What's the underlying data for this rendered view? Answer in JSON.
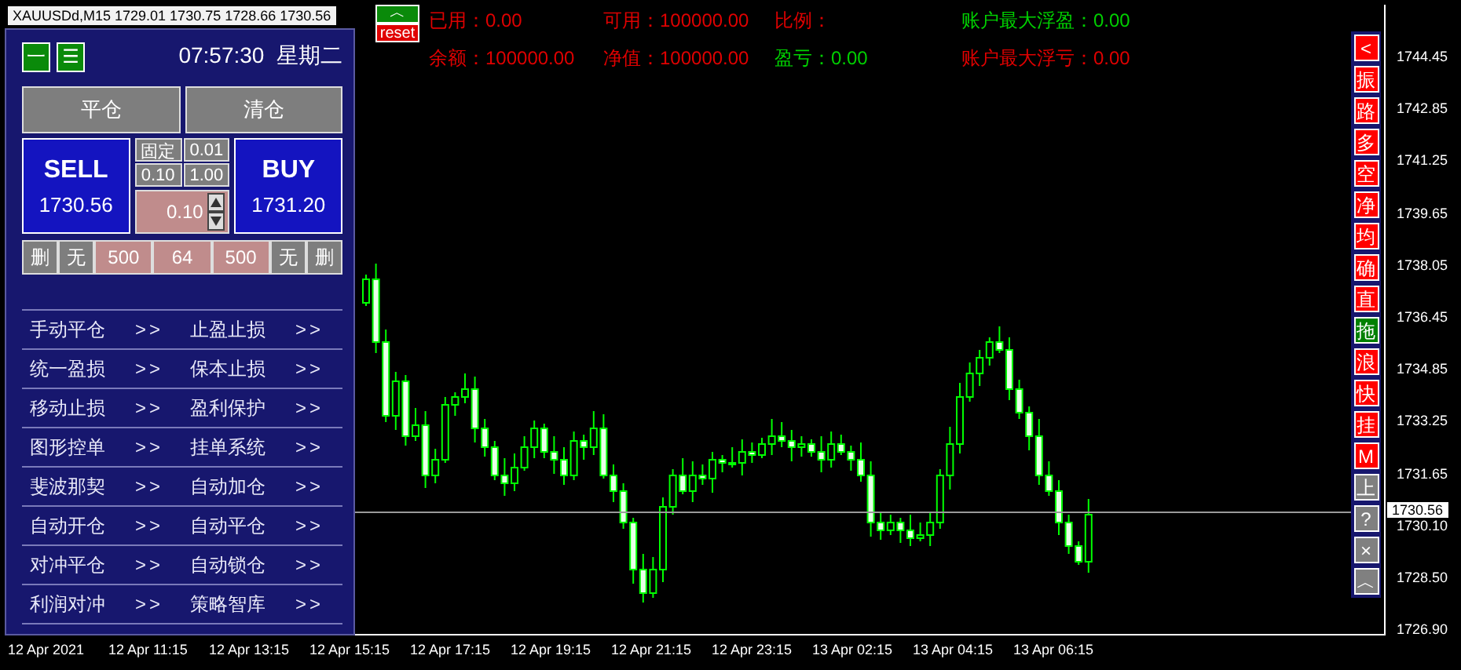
{
  "chart": {
    "header": "XAUUSDd,M15  1729.01 1730.75 1728.66 1730.56"
  },
  "panel": {
    "toggle_buttons": [
      "一",
      "☰"
    ],
    "clock": "07:57:30  星期二",
    "action_buttons": [
      "平仓",
      "清仓"
    ],
    "sell": {
      "label": "SELL",
      "price": "1730.56"
    },
    "buy": {
      "label": "BUY",
      "price": "1731.20"
    },
    "lot_buttons": [
      "固定",
      "0.01",
      "0.10",
      "1.00"
    ],
    "lot_value": "0.10",
    "stop_row": [
      {
        "text": "删",
        "kind": "button"
      },
      {
        "text": "无",
        "kind": "button"
      },
      {
        "text": "500",
        "kind": "field"
      },
      {
        "text": "64",
        "kind": "field"
      },
      {
        "text": "500",
        "kind": "field"
      },
      {
        "text": "无",
        "kind": "button"
      },
      {
        "text": "删",
        "kind": "button"
      }
    ],
    "menu": [
      [
        {
          "label": "手动平仓",
          "arrow": ">>"
        },
        {
          "label": "止盈止损",
          "arrow": ">>"
        }
      ],
      [
        {
          "label": "统一盈损",
          "arrow": ">>"
        },
        {
          "label": "保本止损",
          "arrow": ">>"
        }
      ],
      [
        {
          "label": "移动止损",
          "arrow": ">>"
        },
        {
          "label": "盈利保护",
          "arrow": ">>"
        }
      ],
      [
        {
          "label": "图形控单",
          "arrow": ">>"
        },
        {
          "label": "挂单系统",
          "arrow": ">>"
        }
      ],
      [
        {
          "label": "斐波那契",
          "arrow": ">>"
        },
        {
          "label": "自动加仓",
          "arrow": ">>"
        }
      ],
      [
        {
          "label": "自动开仓",
          "arrow": ">>"
        },
        {
          "label": "自动平仓",
          "arrow": ">>"
        }
      ],
      [
        {
          "label": "对冲平仓",
          "arrow": ">>"
        },
        {
          "label": "自动锁仓",
          "arrow": ">>"
        }
      ],
      [
        {
          "label": "利润对冲",
          "arrow": ">>"
        },
        {
          "label": "策略智库",
          "arrow": ">>"
        }
      ]
    ]
  },
  "account": {
    "collapse_button": "︿",
    "reset_button": "reset",
    "stats": [
      {
        "text": "已用：0.00",
        "color": "#e00000"
      },
      {
        "text": "可用：100000.00",
        "color": "#e00000"
      },
      {
        "text": "比例：",
        "color": "#e00000"
      },
      {
        "text": "账户最大浮盈：0.00",
        "color": "#00d000"
      },
      {
        "text": "余额：100000.00",
        "color": "#e00000"
      },
      {
        "text": "净值：100000.00",
        "color": "#e00000"
      },
      {
        "text": "盈亏：0.00",
        "color": "#00d000"
      },
      {
        "text": "账户最大浮亏：0.00",
        "color": "#e00000"
      }
    ]
  },
  "side_buttons": [
    {
      "text": "<",
      "color": "#ff0000"
    },
    {
      "text": "振",
      "color": "#ff0000"
    },
    {
      "text": "路",
      "color": "#ff0000"
    },
    {
      "text": "多",
      "color": "#ff0000"
    },
    {
      "text": "空",
      "color": "#ff0000"
    },
    {
      "text": "净",
      "color": "#ff0000"
    },
    {
      "text": "均",
      "color": "#ff0000"
    },
    {
      "text": "确",
      "color": "#ff0000"
    },
    {
      "text": "直",
      "color": "#ff0000"
    },
    {
      "text": "拖",
      "color": "#008000"
    },
    {
      "text": "浪",
      "color": "#ff0000"
    },
    {
      "text": "快",
      "color": "#ff0000"
    },
    {
      "text": "挂",
      "color": "#ff0000"
    },
    {
      "text": "M",
      "color": "#ff0000"
    },
    {
      "text": "上",
      "color": "#808080"
    },
    {
      "text": "?",
      "color": "#808080"
    },
    {
      "text": "×",
      "color": "#808080"
    },
    {
      "text": "︿",
      "color": "#808080"
    }
  ],
  "price_axis": {
    "ticks": [
      "1744.45",
      "1742.85",
      "1741.25",
      "1739.65",
      "1738.05",
      "1736.45",
      "1734.85",
      "1733.25",
      "1731.65",
      "1730.10",
      "1728.50",
      "1726.90"
    ],
    "current_price": "1730.56"
  },
  "time_axis": {
    "labels": [
      "12 Apr 2021",
      "12 Apr 11:15",
      "12 Apr 13:15",
      "12 Apr 15:15",
      "12 Apr 17:15",
      "12 Apr 19:15",
      "12 Apr 21:15",
      "12 Apr 23:15",
      "13 Apr 02:15",
      "13 Apr 04:15",
      "13 Apr 06:15"
    ]
  }
}
